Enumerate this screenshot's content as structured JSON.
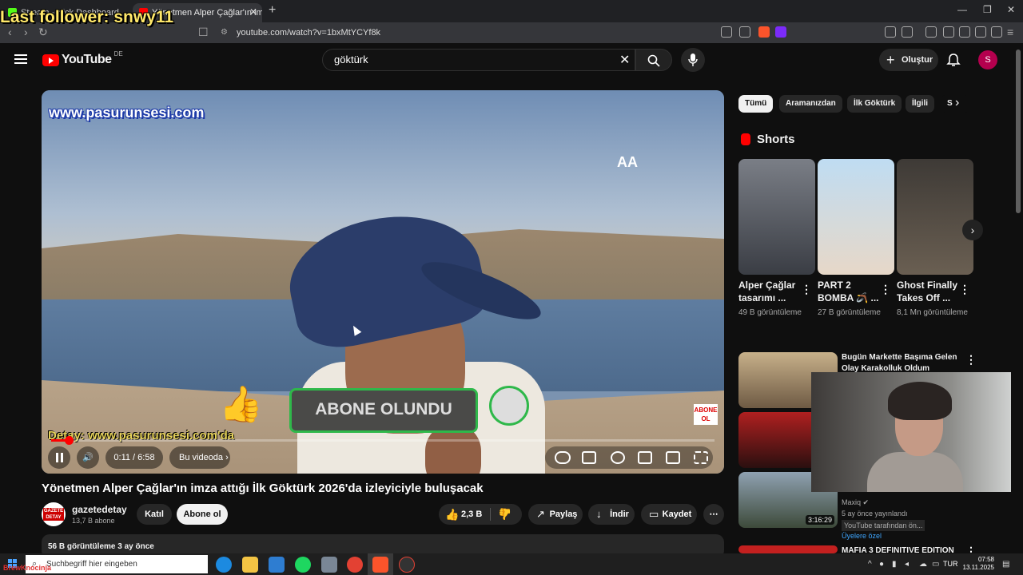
{
  "browser": {
    "tabs": [
      {
        "label": "Stream - Kick Dashboard",
        "favicon_color": "#53fc18"
      },
      {
        "label": "Yönetmen Alper Çağlar'ın ima",
        "favicon_color": "#ff0000",
        "active": true
      }
    ],
    "url": "youtube.com/watch?v=1bxMtYCYf8k"
  },
  "stream_overlay": {
    "follower_text": "Last follower: snwy11",
    "kick_tag": "BrewKnocinja"
  },
  "header": {
    "logo_text": "YouTube",
    "region": "DE",
    "search_query": "göktürk",
    "create_label": "Oluştur",
    "avatar_letter": "S"
  },
  "player": {
    "watermark_url": "www.pasurunsesi.com",
    "subscribed_overlay": "ABONE OLUNDU",
    "detail_text": "Detay: www.pasurunsesi.com'da",
    "abone_badge": "ABONE OL",
    "time": "0:11 / 6:58",
    "progress_fraction": 0.027,
    "chapter_label": "Bu videoda",
    "brand_mark": "AA"
  },
  "video": {
    "title": "Yönetmen Alper Çağlar'ın imza attığı İlk Göktürk 2026'da izleyiciyle buluşacak",
    "channel_name": "gazetedetay",
    "channel_subs": "13,7 B abone",
    "channel_avatar_text": "GAZETE DETAY",
    "join_label": "Katıl",
    "subscribe_label": "Abone ol",
    "like_count": "2,3 B",
    "share_label": "Paylaş",
    "download_label": "İndir",
    "save_label": "Kaydet",
    "description_meta": "56 B görüntüleme  3 ay önce"
  },
  "sidebar": {
    "chips": [
      "Tümü",
      "Aramanızdan",
      "İlk Göktürk",
      "İlgili",
      "S"
    ],
    "shorts_title": "Shorts",
    "shorts": [
      {
        "title": "Alper Çağlar tasarımı ...",
        "views": "49 B görüntüleme"
      },
      {
        "title": "PART 2 BOMBA 🪃 ...",
        "views": "27 B görüntüleme"
      },
      {
        "title": "Ghost Finally Takes Off ...",
        "views": "8,1 Mn görüntüleme"
      }
    ],
    "recommendations": [
      {
        "title": "Bugün Markette Başıma Gelen Olay Karakolluk Oldum",
        "meta": ""
      },
      {
        "title": "",
        "meta": ""
      },
      {
        "title": "",
        "meta": "Maxiq ✔",
        "meta2": "5 ay önce yayınlandı",
        "badge": "YouTube tarafından ön...",
        "members": "Üyelere özel",
        "duration": "3:16:29"
      },
      {
        "title": "MAFIA 3 DEFINITIVE EDITION",
        "meta": ""
      }
    ]
  },
  "taskbar": {
    "search_placeholder": "Suchbegriff hier eingeben",
    "lang": "TUR",
    "time": "07:58",
    "date": "13.11.2025"
  }
}
